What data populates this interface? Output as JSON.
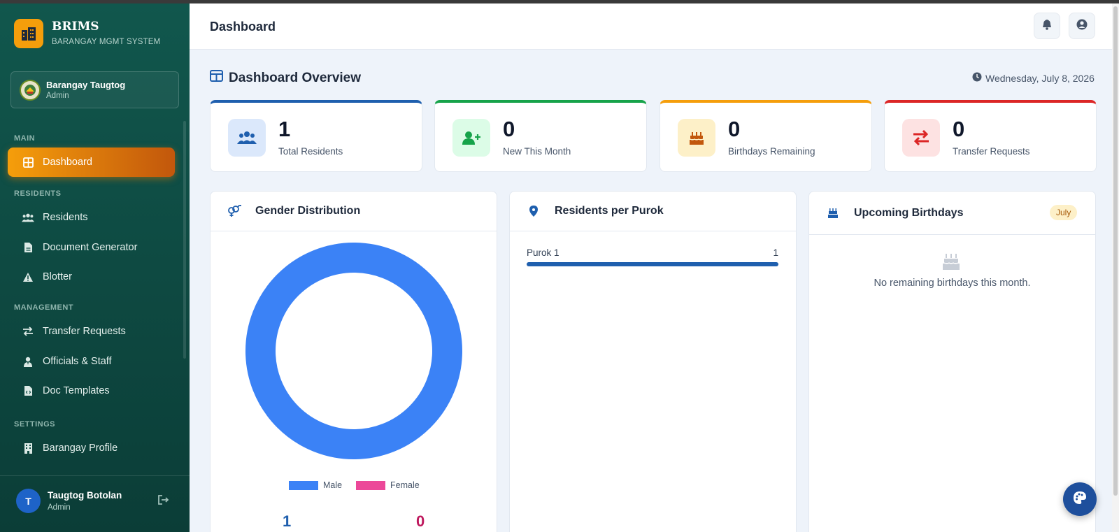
{
  "brand": {
    "title": "BRIMS",
    "subtitle": "BARANGAY MGMT SYSTEM",
    "icon": "building-icon"
  },
  "org": {
    "name": "Barangay Taugtog",
    "role": "Admin",
    "icon": "seal-icon"
  },
  "sidebar": {
    "sections": {
      "main": "MAIN",
      "residents": "RESIDENTS",
      "management": "MANAGEMENT",
      "settings": "SETTINGS"
    },
    "items": [
      {
        "label": "Dashboard",
        "icon": "grid-icon",
        "active": true
      },
      {
        "label": "Residents",
        "icon": "users-icon"
      },
      {
        "label": "Document Generator",
        "icon": "file-icon"
      },
      {
        "label": "Blotter",
        "icon": "warning-icon"
      },
      {
        "label": "Transfer Requests",
        "icon": "transfer-icon"
      },
      {
        "label": "Officials & Staff",
        "icon": "user-tie-icon"
      },
      {
        "label": "Doc Templates",
        "icon": "file-code-icon"
      },
      {
        "label": "Barangay Profile",
        "icon": "building-icon"
      }
    ]
  },
  "user": {
    "initial": "T",
    "name": "Taugtog Botolan",
    "role": "Admin"
  },
  "header": {
    "title": "Dashboard"
  },
  "overview": {
    "title": "Dashboard Overview",
    "date": "Wednesday, July 8, 2026"
  },
  "stats": [
    {
      "value": "1",
      "label": "Total Residents",
      "accent": "#1f5fae",
      "icon": "users-icon"
    },
    {
      "value": "0",
      "label": "New This Month",
      "accent": "#16a34a",
      "icon": "user-plus-icon"
    },
    {
      "value": "0",
      "label": "Birthdays Remaining",
      "accent": "#f59e0b",
      "icon": "cake-icon"
    },
    {
      "value": "0",
      "label": "Transfer Requests",
      "accent": "#dc2626",
      "icon": "transfer-icon"
    }
  ],
  "gender": {
    "title": "Gender Distribution",
    "legend": {
      "male": "Male",
      "female": "Female"
    },
    "male_count": "1",
    "female_count": "0",
    "male_color": "#3b82f6",
    "female_color": "#ec4899"
  },
  "chart_data": {
    "type": "pie",
    "categories": [
      "Male",
      "Female"
    ],
    "values": [
      1,
      0
    ],
    "title": "",
    "legend": "bottom"
  },
  "purok": {
    "title": "Residents per Purok",
    "rows": [
      {
        "name": "Purok 1",
        "value": "1",
        "fraction": 1.0
      }
    ]
  },
  "birthdays": {
    "title": "Upcoming Birthdays",
    "badge": "July",
    "empty_text": "No remaining birthdays this month."
  },
  "colors": {
    "sidebar": "#0e4a42",
    "accent": "#f59e0b",
    "primary": "#1f5fae"
  }
}
